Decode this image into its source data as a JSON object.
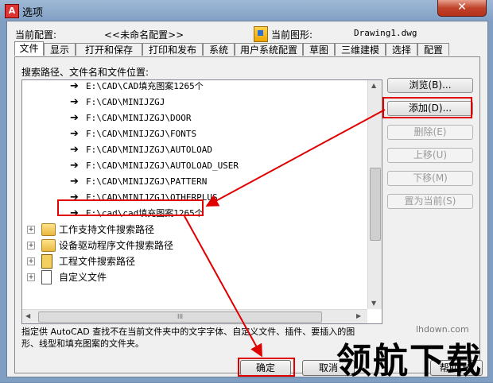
{
  "window": {
    "title": "选项",
    "close_icon": "close-icon"
  },
  "config": {
    "current_config_label": "当前配置:",
    "current_config_value": "<<未命名配置>>",
    "current_drawing_label": "当前图形:",
    "current_drawing_value": "Drawing1.dwg"
  },
  "tabs": [
    "文件",
    "显示",
    "打开和保存",
    "打印和发布",
    "系统",
    "用户系统配置",
    "草图",
    "三维建模",
    "选择",
    "配置"
  ],
  "active_tab": "文件",
  "search_label": "搜索路径、文件名和文件位置:",
  "tree": {
    "paths": [
      "E:\\CAD\\CAD填充图案1265个",
      "F:\\CAD\\MINIJZGJ",
      "F:\\CAD\\MINIJZGJ\\DOOR",
      "F:\\CAD\\MINIJZGJ\\FONTS",
      "F:\\CAD\\MINIJZGJ\\AUTOLOAD",
      "F:\\CAD\\MINIJZGJ\\AUTOLOAD_USER",
      "F:\\CAD\\MINIJZGJ\\PATTERN",
      "F:\\CAD\\MINIJZGJ\\OTHERPLUS",
      "E:\\cad\\cad填充图案1265个"
    ],
    "roots": [
      "工作支持文件搜索路径",
      "设备驱动程序文件搜索路径",
      "工程文件搜索路径",
      "自定义文件"
    ],
    "hscroll_grip": "III"
  },
  "buttons": {
    "browse": "浏览(B)...",
    "add": "添加(D)...",
    "remove": "删除(E)",
    "move_up": "上移(U)",
    "move_down": "下移(M)",
    "set_current": "置为当前(S)"
  },
  "description": "指定供 AutoCAD 查找不在当前文件夹中的文字字体、自定义文件、插件、要插入的图\n形、线型和填充图案的文件夹。",
  "dialog_buttons": {
    "ok": "确定",
    "cancel": "取消",
    "help": "帮助(H)"
  },
  "watermark": {
    "text": "领航下载",
    "url": "lhdown.com"
  },
  "annotation_color": "#e00000"
}
